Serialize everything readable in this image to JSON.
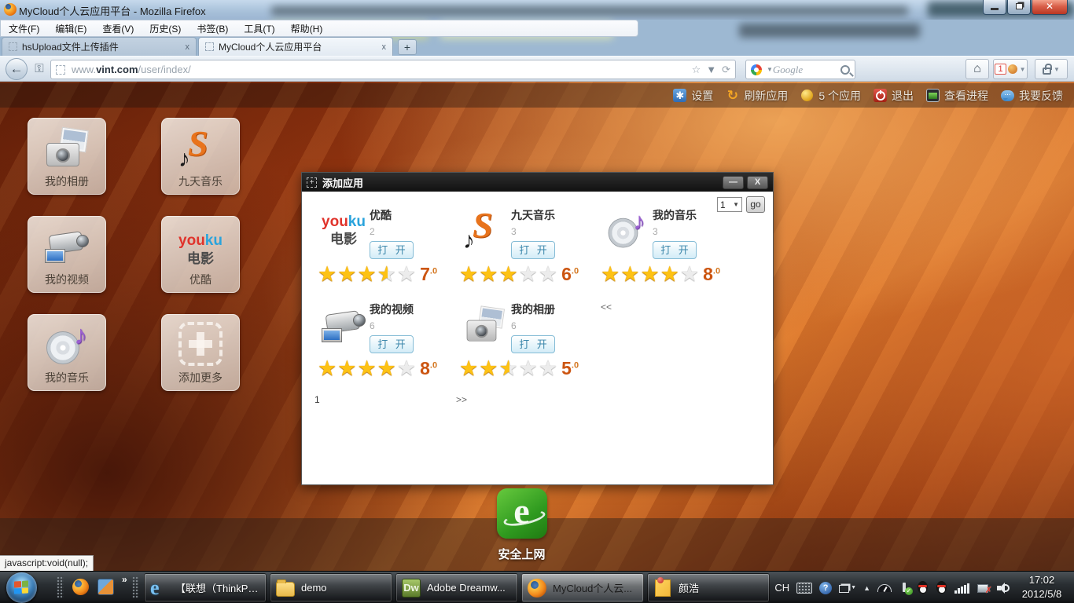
{
  "browser": {
    "title": "MyCloud个人云应用平台 - Mozilla Firefox",
    "menu": [
      "文件(F)",
      "编辑(E)",
      "查看(V)",
      "历史(S)",
      "书签(B)",
      "工具(T)",
      "帮助(H)"
    ],
    "tabs": [
      {
        "label": "hsUpload文件上传插件",
        "close": "x"
      },
      {
        "label": "MyCloud个人云应用平台",
        "close": "x"
      }
    ],
    "new_tab_label": "+",
    "url": {
      "prefix": "www.",
      "host": "vint.com",
      "path": "/user/index/"
    },
    "search_placeholder": "Google",
    "addon_badge": "1"
  },
  "page_header": {
    "items": [
      {
        "label": "设置"
      },
      {
        "label": "刷新应用"
      },
      {
        "label": "5 个应用"
      },
      {
        "label": "退出"
      },
      {
        "label": "查看进程"
      },
      {
        "label": "我要反馈"
      }
    ]
  },
  "tiles": [
    {
      "label": "我的相册"
    },
    {
      "label": "九天音乐"
    },
    {
      "label": "我的视频"
    },
    {
      "label": "优酷",
      "logo_you": "you",
      "logo_ku": "ku",
      "logo_sub": "电影"
    },
    {
      "label": "我的音乐"
    },
    {
      "label": "添加更多"
    }
  ],
  "dialog": {
    "title": "添加应用",
    "title_icon": "+",
    "minimize": "—",
    "close": "X",
    "page_select": "1",
    "go": "go",
    "apps": [
      {
        "name": "优酷",
        "count": "2",
        "open": "打 开",
        "stars": 3.5,
        "rating": "7",
        "rating_decimal": ".0",
        "logo_you": "you",
        "logo_ku": "ku",
        "logo_sub": "电影"
      },
      {
        "name": "九天音乐",
        "count": "3",
        "open": "打 开",
        "stars": 3,
        "rating": "6",
        "rating_decimal": ".0"
      },
      {
        "name": "我的音乐",
        "count": "3",
        "open": "打 开",
        "stars": 4,
        "rating": "8",
        "rating_decimal": ".0"
      },
      {
        "name": "我的视频",
        "count": "6",
        "open": "打 开",
        "stars": 4,
        "rating": "8",
        "rating_decimal": ".0"
      },
      {
        "name": "我的相册",
        "count": "6",
        "open": "打 开",
        "stars": 2.5,
        "rating": "5",
        "rating_decimal": ".0"
      }
    ],
    "prev": "<<",
    "next": ">>",
    "page_number": "1"
  },
  "desktop": {
    "shortcut_label": "安全上网",
    "status_tooltip": "javascript:void(null);"
  },
  "taskbar": {
    "overflow_chevron": "»",
    "buttons": [
      {
        "label": "【联想（ThinkPa..."
      },
      {
        "label": "demo"
      },
      {
        "label": "Adobe Dreamw...",
        "badge": "Dw"
      },
      {
        "label": "MyCloud个人云...",
        "active": true
      },
      {
        "label": "颜浩"
      }
    ],
    "tray": {
      "lang": "CH",
      "time": "17:02",
      "date": "2012/5/8"
    }
  }
}
